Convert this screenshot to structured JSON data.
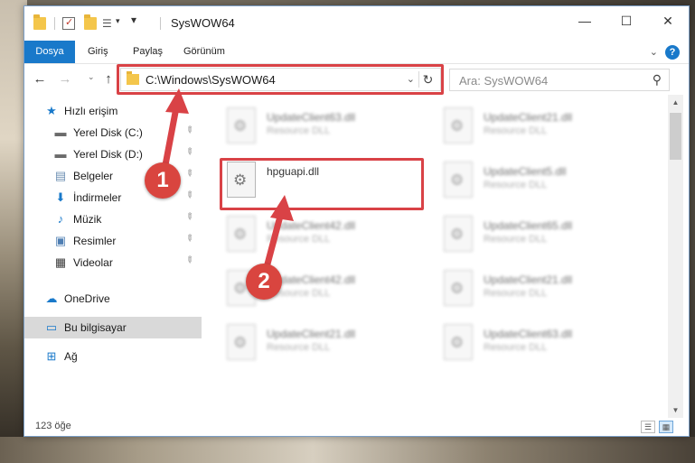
{
  "window": {
    "title": "SysWOW64",
    "minimize": "—",
    "maximize": "☐",
    "close": "✕"
  },
  "ribbon": {
    "tabs": [
      "Dosya",
      "Giriş",
      "Paylaş",
      "Görünüm"
    ],
    "expand": "⌄",
    "help": "?"
  },
  "nav": {
    "back": "←",
    "forward": "→",
    "recent": "⌄",
    "up": "↑",
    "address": "C:\\Windows\\SysWOW64",
    "address_dropdown": "⌄",
    "refresh": "↻",
    "search_placeholder": "Ara: SysWOW64",
    "search_icon": "⚲"
  },
  "sidebar": {
    "items": [
      {
        "label": "Hızlı erişim",
        "icon": "★",
        "icon_name": "star-icon",
        "color": "#1979ca"
      },
      {
        "label": "Yerel Disk (C:)",
        "icon": "▬",
        "icon_name": "drive-icon",
        "color": "#6b6b6b",
        "pinned": true
      },
      {
        "label": "Yerel Disk (D:)",
        "icon": "▬",
        "icon_name": "drive-icon",
        "color": "#6b6b6b",
        "pinned": true
      },
      {
        "label": "Belgeler",
        "icon": "▤",
        "icon_name": "documents-icon",
        "color": "#6d8fb3",
        "pinned": true
      },
      {
        "label": "İndirmeler",
        "icon": "⬇",
        "icon_name": "downloads-icon",
        "color": "#1979ca",
        "pinned": true
      },
      {
        "label": "Müzik",
        "icon": "♪",
        "icon_name": "music-icon",
        "color": "#1979ca",
        "pinned": true
      },
      {
        "label": "Resimler",
        "icon": "▣",
        "icon_name": "pictures-icon",
        "color": "#4f7fb3",
        "pinned": true
      },
      {
        "label": "Videolar",
        "icon": "▦",
        "icon_name": "videos-icon",
        "color": "#3b3b3b",
        "pinned": true
      },
      {
        "label": "OneDrive",
        "icon": "☁",
        "icon_name": "onedrive-icon",
        "color": "#1979ca"
      },
      {
        "label": "Bu bilgisayar",
        "icon": "▭",
        "icon_name": "computer-icon",
        "color": "#1979ca",
        "selected": true
      },
      {
        "label": "Ağ",
        "icon": "⊞",
        "icon_name": "network-icon",
        "color": "#1979ca"
      }
    ],
    "pin_glyph": "📌"
  },
  "files": [
    {
      "name": "UpdateClient63.dll",
      "type": "Resource DLL",
      "blurred": true
    },
    {
      "name": "UpdateClient21.dll",
      "type": "Resource DLL",
      "blurred": true
    },
    {
      "name": "hpguapi.dll",
      "type": "",
      "blurred": false,
      "highlighted": true
    },
    {
      "name": "UpdateClient5.dll",
      "type": "Resource DLL",
      "blurred": true
    },
    {
      "name": "UpdateClient42.dll",
      "type": "Resource DLL",
      "blurred": true
    },
    {
      "name": "UpdateClient65.dll",
      "type": "Resource DLL",
      "blurred": true
    },
    {
      "name": "UpdateClient42.dll",
      "type": "Resource DLL",
      "blurred": true
    },
    {
      "name": "UpdateClient21.dll",
      "type": "Resource DLL",
      "blurred": true
    },
    {
      "name": "UpdateClient21.dll",
      "type": "Resource DLL",
      "blurred": true
    },
    {
      "name": "UpdateClient63.dll",
      "type": "Resource DLL",
      "blurred": true
    }
  ],
  "status": {
    "count": "123 öğe"
  },
  "annotations": {
    "step1": "1",
    "step2": "2",
    "color": "#d94246"
  }
}
